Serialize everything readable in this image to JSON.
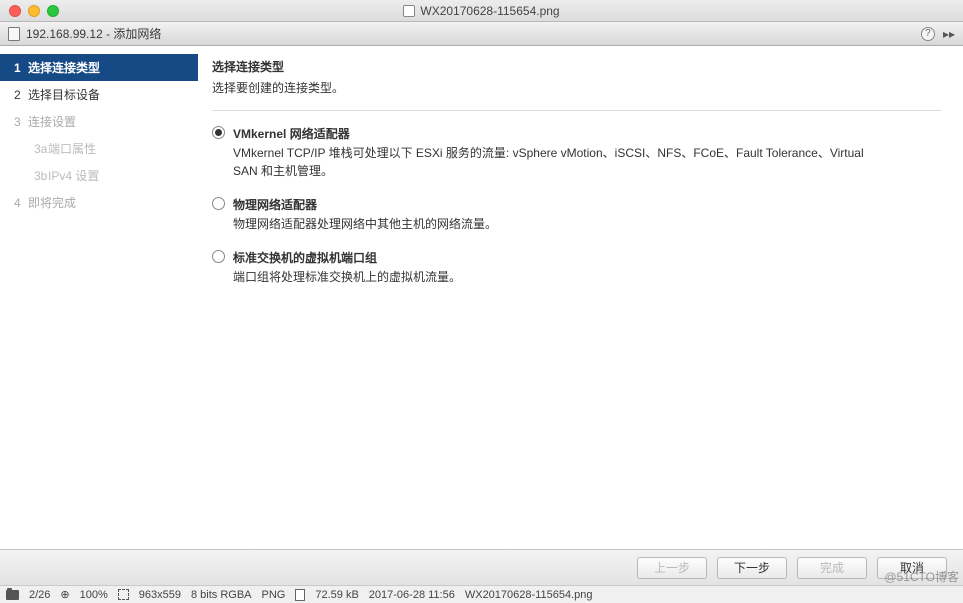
{
  "mac_title": "WX20170628-115654.png",
  "dialog_title": "192.168.99.12 - 添加网络",
  "sidebar": {
    "steps": [
      {
        "num": "1",
        "label": "选择连接类型"
      },
      {
        "num": "2",
        "label": "选择目标设备"
      },
      {
        "num": "3",
        "label": "连接设置"
      },
      {
        "num": "3a",
        "label": "端口属性"
      },
      {
        "num": "3b",
        "label": "IPv4 设置"
      },
      {
        "num": "4",
        "label": "即将完成"
      }
    ]
  },
  "content": {
    "title": "选择连接类型",
    "subtitle": "选择要创建的连接类型。",
    "options": [
      {
        "label": "VMkernel 网络适配器",
        "desc": "VMkernel TCP/IP 堆栈可处理以下 ESXi 服务的流量: vSphere vMotion、iSCSI、NFS、FCoE、Fault Tolerance、Virtual SAN 和主机管理。"
      },
      {
        "label": "物理网络适配器",
        "desc": "物理网络适配器处理网络中其他主机的网络流量。"
      },
      {
        "label": "标准交换机的虚拟机端口组",
        "desc": "端口组将处理标准交换机上的虚拟机流量。"
      }
    ]
  },
  "footer": {
    "back": "上一步",
    "next": "下一步",
    "finish": "完成",
    "cancel": "取消"
  },
  "statusbar": {
    "index": "2/26",
    "zoom": "100%",
    "dims": "963x559",
    "depth": "8 bits RGBA",
    "format": "PNG",
    "size": "72.59 kB",
    "date": "2017-06-28 11:56",
    "filename": "WX20170628-115654.png"
  },
  "watermark": "@51CTO博客"
}
